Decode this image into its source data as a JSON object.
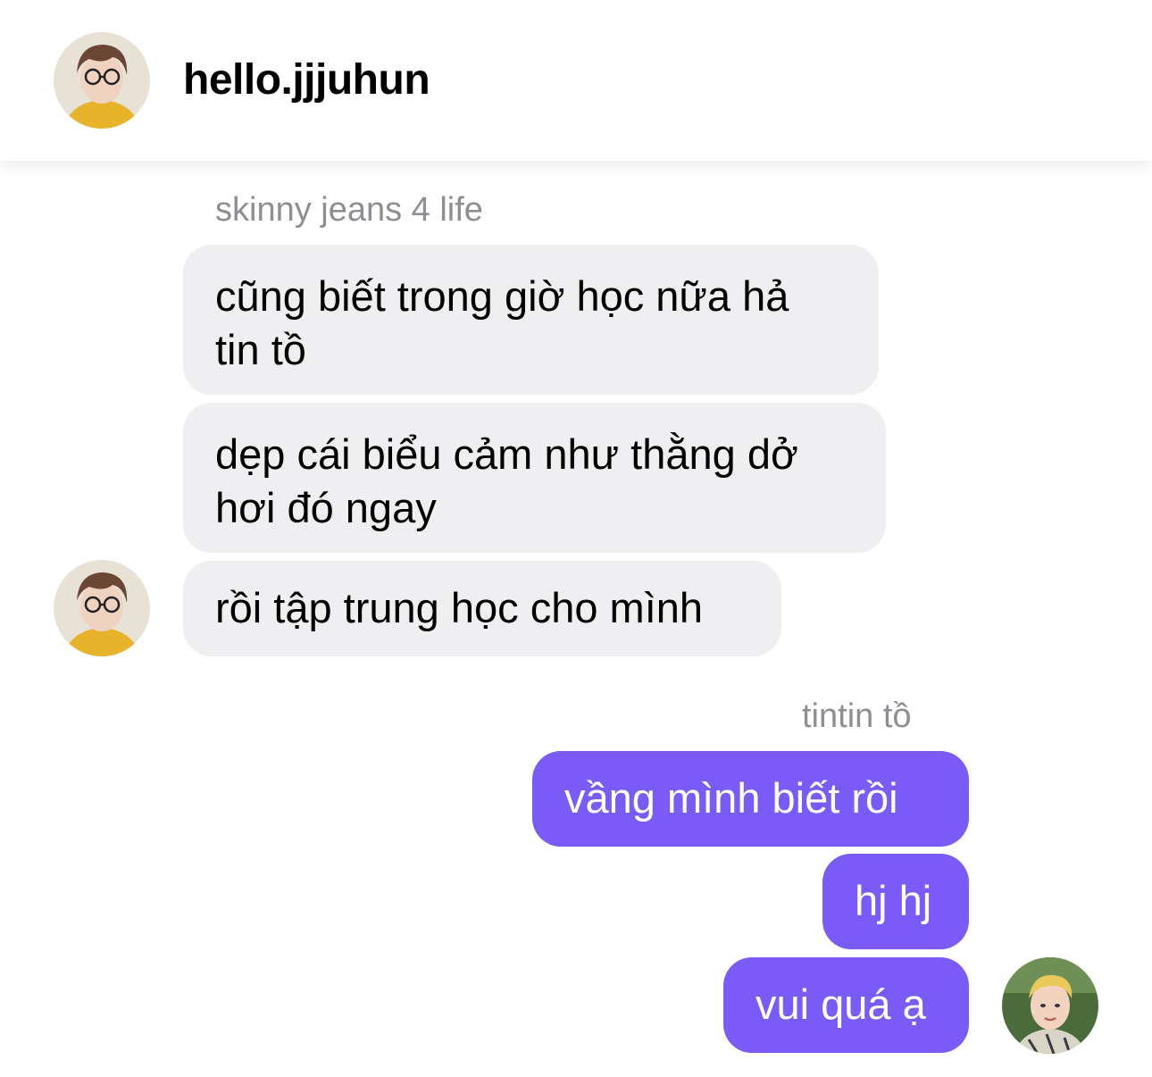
{
  "header": {
    "title": "hello.jjjuhun",
    "avatar_icon": "profile-avatar-icon"
  },
  "incoming": {
    "sender": "skinny jeans 4 life",
    "messages": [
      {
        "line1": "cũng biết trong giờ học nữa hả",
        "line2": "tin tồ"
      },
      {
        "line1": "dẹp cái biểu cảm như thằng dở",
        "line2": "hơi đó ngay"
      },
      {
        "line1": "rồi tập trung học cho mình"
      }
    ]
  },
  "outgoing": {
    "sender": "tintin tồ",
    "messages": [
      {
        "text": "vầng mình biết rồi"
      },
      {
        "text": "hj hj"
      },
      {
        "text": "vui quá ạ"
      }
    ]
  },
  "colors": {
    "incoming_bubble": "#efeff2",
    "outgoing_bubble": "#7b5bf7",
    "sender_name": "#8e8e93"
  }
}
